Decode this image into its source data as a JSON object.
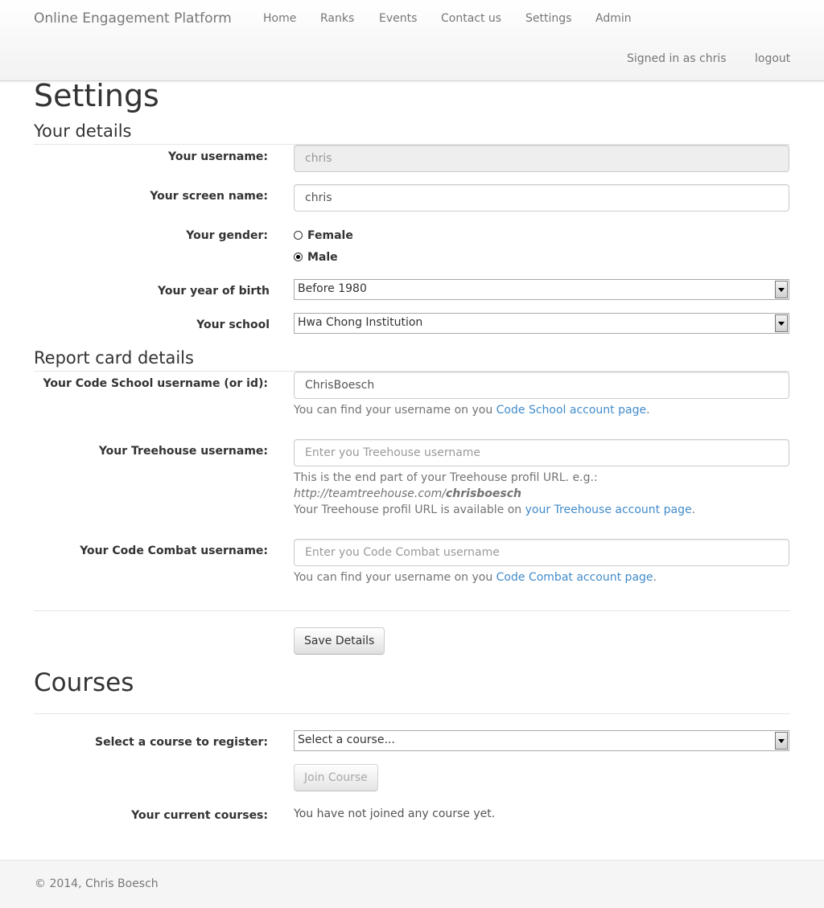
{
  "navbar": {
    "brand": "Online Engagement Platform",
    "items": [
      {
        "label": "Home"
      },
      {
        "label": "Ranks"
      },
      {
        "label": "Events"
      },
      {
        "label": "Contact us"
      },
      {
        "label": "Settings"
      },
      {
        "label": "Admin"
      }
    ],
    "signed_in": "Signed in as chris",
    "logout": "logout"
  },
  "page": {
    "title": "Settings"
  },
  "your_details": {
    "heading": "Your details",
    "username": {
      "label": "Your username:",
      "value": "chris"
    },
    "screen_name": {
      "label": "Your screen name:",
      "value": "chris"
    },
    "gender": {
      "label": "Your gender:",
      "options": [
        "Female",
        "Male"
      ],
      "selected": "Male"
    },
    "year_of_birth": {
      "label": "Your year of birth",
      "value": "Before 1980"
    },
    "school": {
      "label": "Your school",
      "value": "Hwa Chong Institution"
    }
  },
  "report_card": {
    "heading": "Report card details",
    "codeschool": {
      "label": "Your Code School username (or id):",
      "value": "ChrisBoesch",
      "help_prefix": "You can find your username on you ",
      "help_link": "Code School account page",
      "help_suffix": "."
    },
    "treehouse": {
      "label": "Your Treehouse username:",
      "placeholder": "Enter you Treehouse username",
      "help_line1": "This is the end part of your Treehouse profil URL. e.g.:",
      "help_url_base": "http://teamtreehouse.com/",
      "help_url_user": "chrisboesch",
      "help_line3_prefix": "Your Treehouse profil URL is available on ",
      "help_line3_link": "your Treehouse account page",
      "help_line3_suffix": "."
    },
    "codecombat": {
      "label": "Your Code Combat username:",
      "placeholder": "Enter you Code Combat username",
      "help_prefix": "You can find your username on you ",
      "help_link": "Code Combat account page",
      "help_suffix": "."
    },
    "save_label": "Save Details"
  },
  "courses": {
    "heading": "Courses",
    "select_label": "Select a course to register:",
    "select_value": "Select a course...",
    "join_label": "Join Course",
    "current_label": "Your current courses:",
    "current_value": "You have not joined any course yet."
  },
  "footer": {
    "text": "© 2014, Chris Boesch"
  }
}
